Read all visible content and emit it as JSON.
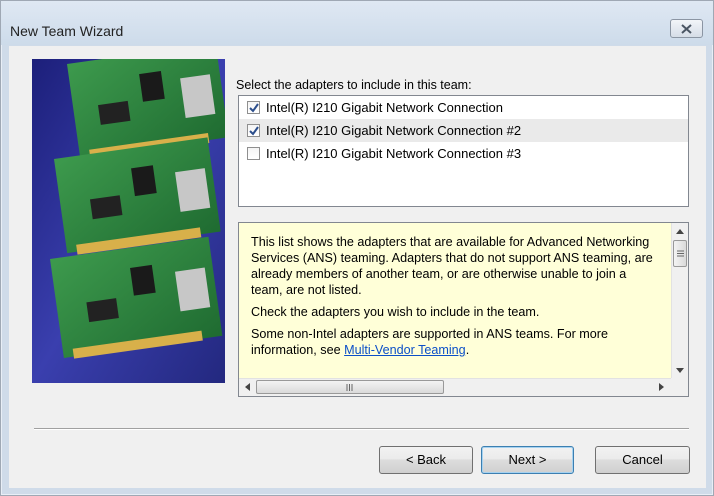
{
  "window": {
    "title": "New Team Wizard"
  },
  "adapters": {
    "prompt": "Select the adapters to include in this team:",
    "items": [
      {
        "label": "Intel(R) I210 Gigabit Network Connection",
        "checked": true
      },
      {
        "label": "Intel(R) I210 Gigabit Network Connection #2",
        "checked": true
      },
      {
        "label": "Intel(R) I210 Gigabit Network Connection #3",
        "checked": false
      }
    ]
  },
  "info": {
    "paragraph1": "This list shows the adapters that are available for Advanced Networking Services (ANS) teaming. Adapters that do not support ANS teaming, are already members of another team, or are otherwise unable to join a team, are not listed.",
    "paragraph2": "Check the adapters you wish to include in the team.",
    "paragraph3_prefix": "Some non-Intel adapters are supported in ANS teams. For more information, see ",
    "link": "Multi-Vendor Teaming",
    "paragraph3_suffix": "."
  },
  "buttons": {
    "back": "< Back",
    "next": "Next >",
    "cancel": "Cancel"
  },
  "colors": {
    "info_background": "#ffffd8",
    "link": "#0b4fc8",
    "chrome": "#cfdbe9"
  },
  "icons": {
    "close": "close-icon",
    "checkbox_checked": "checkmark-icon"
  }
}
